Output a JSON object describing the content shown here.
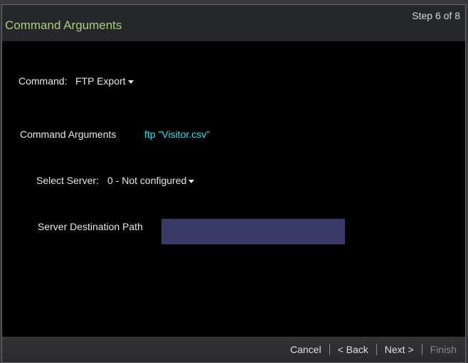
{
  "header": {
    "title": "Command Arguments",
    "step": "Step 6 of 8"
  },
  "form": {
    "command_label": "Command:",
    "command_value": "FTP Export",
    "args_label": "Command Arguments",
    "args_value": "ftp \"Visitor.csv\"",
    "server_label": "Select Server:",
    "server_value": "0 - Not configured",
    "path_label": "Server Destination Path",
    "path_value": ""
  },
  "footer": {
    "cancel": "Cancel",
    "back": "< Back",
    "next": "Next >",
    "finish": "Finish"
  }
}
